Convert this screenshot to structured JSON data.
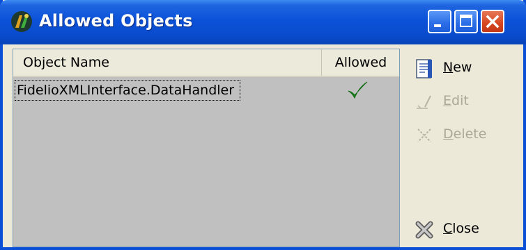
{
  "window": {
    "title": "Allowed Objects"
  },
  "list": {
    "columns": [
      "Object Name",
      "Allowed"
    ],
    "rows": [
      {
        "object_name": "FidelioXMLInterface.DataHandler",
        "allowed": true
      }
    ]
  },
  "buttons": {
    "new": {
      "accel": "N",
      "rest": "ew",
      "enabled": true
    },
    "edit": {
      "accel": "E",
      "rest": "dit",
      "enabled": false
    },
    "delete": {
      "accel": "D",
      "rest": "elete",
      "enabled": false
    },
    "close": {
      "accel": "C",
      "rest": "lose",
      "enabled": true
    }
  },
  "icons": {
    "app": "app-icon",
    "minimize": "minimize-icon",
    "maximize": "maximize-icon",
    "close": "close-icon",
    "new": "new-document-icon",
    "edit": "edit-icon",
    "delete": "delete-icon",
    "close_button": "close-x-icon",
    "checkmark": "checkmark-icon"
  },
  "colors": {
    "titlebar": "#0a4bcc",
    "checkmark": "#1a8a1a",
    "list_background": "#c0c0c0"
  }
}
